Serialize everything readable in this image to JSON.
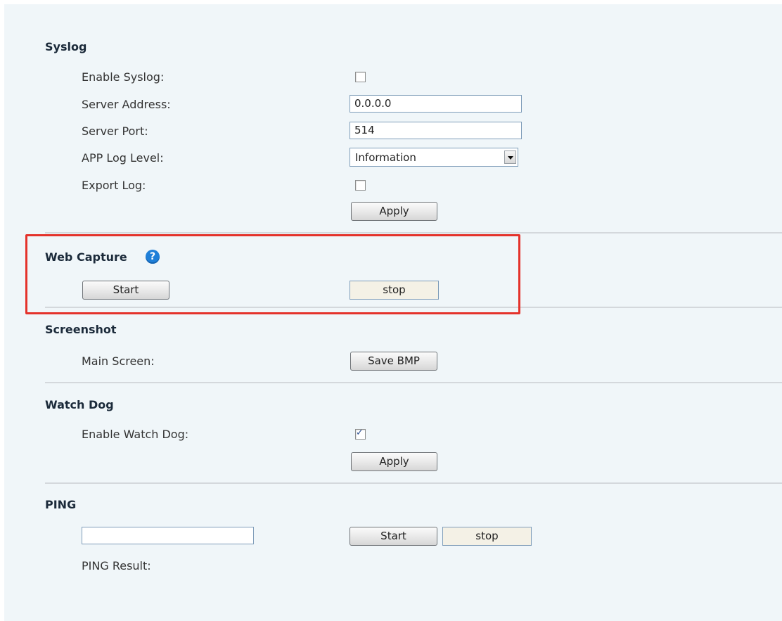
{
  "syslog": {
    "title": "Syslog",
    "enable_label": "Enable Syslog:",
    "enable_checked": false,
    "server_address_label": "Server Address:",
    "server_address_value": "0.0.0.0",
    "server_port_label": "Server Port:",
    "server_port_value": "514",
    "app_log_level_label": "APP Log Level:",
    "app_log_level_value": "Information",
    "export_log_label": "Export Log:",
    "export_log_checked": false,
    "apply_label": "Apply"
  },
  "web_capture": {
    "title": "Web Capture",
    "help_icon": "question-icon",
    "start_label": "Start",
    "stop_label": "stop",
    "highlight_color": "#e4322b"
  },
  "screenshot": {
    "title": "Screenshot",
    "main_screen_label": "Main Screen:",
    "save_bmp_label": "Save BMP"
  },
  "watch_dog": {
    "title": "Watch Dog",
    "enable_label": "Enable Watch Dog:",
    "enable_checked": true,
    "apply_label": "Apply"
  },
  "ping": {
    "title": "PING",
    "input_value": "",
    "start_label": "Start",
    "stop_label": "stop",
    "result_label": "PING Result:"
  }
}
